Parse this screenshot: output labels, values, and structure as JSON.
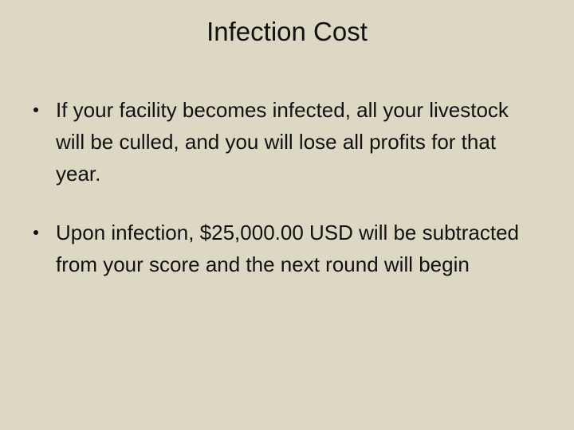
{
  "slide": {
    "title": "Infection Cost",
    "bullets": [
      {
        "text": "If your facility becomes infected, all your livestock will be culled, and you will lose all profits for that year."
      },
      {
        "text": "Upon infection, $25,000.00 USD will be subtracted from your score and the next round will begin"
      }
    ]
  },
  "colors": {
    "background": "#ddd8c3",
    "text": "#111111"
  }
}
